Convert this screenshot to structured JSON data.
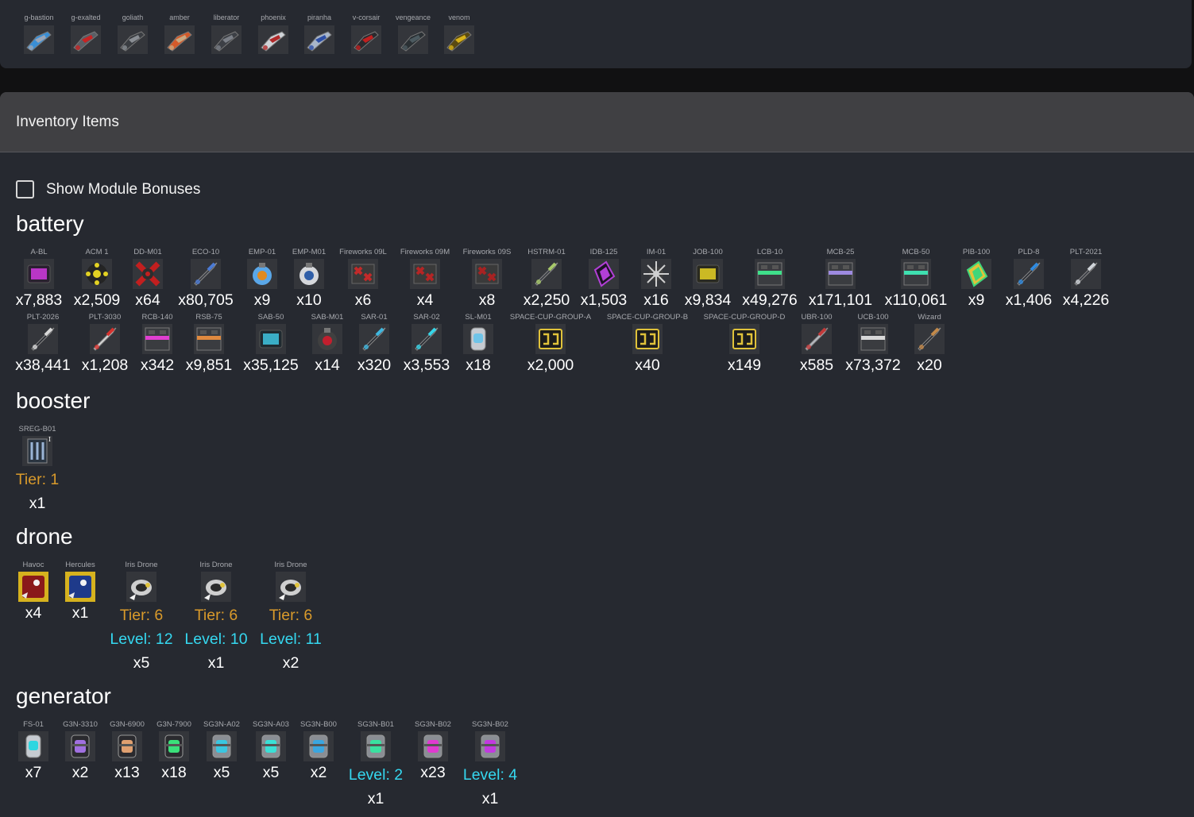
{
  "ships": [
    {
      "name": "g-bastion",
      "colors": [
        "#9aa6b8",
        "#3a8fd6"
      ]
    },
    {
      "name": "g-exalted",
      "colors": [
        "#c72323",
        "#5a5f66"
      ]
    },
    {
      "name": "goliath",
      "colors": [
        "#8a8e94",
        "#3a3d42"
      ]
    },
    {
      "name": "amber",
      "colors": [
        "#c9a880",
        "#d35a2a"
      ]
    },
    {
      "name": "liberator",
      "colors": [
        "#7c8088",
        "#3d4046"
      ]
    },
    {
      "name": "phoenix",
      "colors": [
        "#b02a2a",
        "#cfd3d8"
      ]
    },
    {
      "name": "piranha",
      "colors": [
        "#2d4fa6",
        "#a9b6c9"
      ]
    },
    {
      "name": "v-corsair",
      "colors": [
        "#c01f1f",
        "#2a2a2e"
      ]
    },
    {
      "name": "vengeance",
      "colors": [
        "#4c5a60",
        "#2a3034"
      ]
    },
    {
      "name": "venom",
      "colors": [
        "#d8b21a",
        "#5a4a12"
      ]
    }
  ],
  "inventory": {
    "title": "Inventory Items",
    "show_bonuses_label": "Show Module Bonuses",
    "categories": [
      {
        "name": "battery",
        "items": [
          {
            "name": "A-BL",
            "qty": "x7,883",
            "icon": "box-icon",
            "colors": [
              "#d23be0",
              "#2a2030"
            ]
          },
          {
            "name": "ACM 1",
            "qty": "x2,509",
            "icon": "mine-icon",
            "colors": [
              "#e3d223",
              "#242424"
            ]
          },
          {
            "name": "DD-M01",
            "qty": "x64",
            "icon": "x-mine-icon",
            "colors": [
              "#c21f1f",
              "#2d2d2d"
            ]
          },
          {
            "name": "ECO-10",
            "qty": "x80,705",
            "icon": "rocket-icon",
            "colors": [
              "#4b7bd6",
              "#3a3d44"
            ]
          },
          {
            "name": "EMP-01",
            "qty": "x9",
            "icon": "emp-icon",
            "colors": [
              "#e08a1f",
              "#5aa7e8"
            ]
          },
          {
            "name": "EMP-M01",
            "qty": "x10",
            "icon": "emp-icon",
            "colors": [
              "#2f5ea8",
              "#d6d8dc"
            ]
          },
          {
            "name": "Fireworks 09L",
            "qty": "x6",
            "icon": "firework-box-icon",
            "colors": [
              "#c22a2a",
              "#3a3a3a"
            ]
          },
          {
            "name": "Fireworks 09M",
            "qty": "x4",
            "icon": "firework-box-icon",
            "colors": [
              "#b52525",
              "#3a3a3a"
            ]
          },
          {
            "name": "Fireworks 09S",
            "qty": "x8",
            "icon": "firework-box-icon",
            "colors": [
              "#a82222",
              "#3a3a3a"
            ]
          },
          {
            "name": "HSTRM-01",
            "qty": "x2,250",
            "icon": "rocket-icon",
            "colors": [
              "#a8c96a",
              "#3a3d44"
            ]
          },
          {
            "name": "IDB-125",
            "qty": "x1,503",
            "icon": "crystal-icon",
            "colors": [
              "#b23fd6",
              "#1c1424"
            ]
          },
          {
            "name": "IM-01",
            "qty": "x16",
            "icon": "spiky-mine-icon",
            "colors": [
              "#cfcfcf",
              "#404040"
            ]
          },
          {
            "name": "JOB-100",
            "qty": "x9,834",
            "icon": "box-icon",
            "colors": [
              "#e7d226",
              "#2a2a20"
            ]
          },
          {
            "name": "LCB-10",
            "qty": "x49,276",
            "icon": "crate-icon",
            "colors": [
              "#3fe08a",
              "#3a3c40"
            ]
          },
          {
            "name": "MCB-25",
            "qty": "x171,101",
            "icon": "crate-icon",
            "colors": [
              "#9d8ae0",
              "#3a3c40"
            ]
          },
          {
            "name": "MCB-50",
            "qty": "x110,061",
            "icon": "crate-icon",
            "colors": [
              "#3fe0b0",
              "#3a3c40"
            ]
          },
          {
            "name": "PIB-100",
            "qty": "x9",
            "icon": "crystal-icon",
            "colors": [
              "#3fd67a",
              "#e0c23a"
            ]
          },
          {
            "name": "PLD-8",
            "qty": "x1,406",
            "icon": "rocket-icon",
            "colors": [
              "#2f8be0",
              "#2a2d33"
            ]
          },
          {
            "name": "PLT-2021",
            "qty": "x4,226",
            "icon": "rocket-icon",
            "colors": [
              "#cfd3d8",
              "#3a3d44"
            ]
          }
        ],
        "items2": [
          {
            "name": "PLT-2026",
            "qty": "x38,441",
            "icon": "rocket-icon",
            "colors": [
              "#d8d8d8",
              "#2a2d33"
            ]
          },
          {
            "name": "PLT-3030",
            "qty": "x1,208",
            "icon": "rocket-icon",
            "colors": [
              "#d6322e",
              "#d8d8d8"
            ]
          },
          {
            "name": "RCB-140",
            "qty": "x342",
            "icon": "crate-icon",
            "colors": [
              "#e03fd0",
              "#3a3c40"
            ]
          },
          {
            "name": "RSB-75",
            "qty": "x9,851",
            "icon": "crate-icon",
            "colors": [
              "#e08a3f",
              "#3a3c40"
            ]
          },
          {
            "name": "SAB-50",
            "qty": "x35,125",
            "icon": "box-icon",
            "colors": [
              "#3fc6e0",
              "#1f2a30"
            ]
          },
          {
            "name": "SAB-M01",
            "qty": "x14",
            "icon": "emp-icon",
            "colors": [
              "#c21f2e",
              "#404040"
            ]
          },
          {
            "name": "SAR-01",
            "qty": "x320",
            "icon": "rocket-icon",
            "colors": [
              "#3fb8e0",
              "#2a2d33"
            ]
          },
          {
            "name": "SAR-02",
            "qty": "x3,553",
            "icon": "rocket-icon",
            "colors": [
              "#36d6e8",
              "#2a2d33"
            ]
          },
          {
            "name": "SL-M01",
            "qty": "x18",
            "icon": "canister-icon",
            "colors": [
              "#6fc4e8",
              "#c6cbd1"
            ]
          },
          {
            "name": "SPACE-CUP-GROUP-A",
            "qty": "x2,000",
            "icon": "cup-box-icon",
            "colors": [
              "#e0c23a",
              "#1c1c1c"
            ]
          },
          {
            "name": "SPACE-CUP-GROUP-B",
            "qty": "x40",
            "icon": "cup-box-icon",
            "colors": [
              "#e0c23a",
              "#1c1c1c"
            ]
          },
          {
            "name": "SPACE-CUP-GROUP-D",
            "qty": "x149",
            "icon": "cup-box-icon",
            "colors": [
              "#e0c23a",
              "#1c1c1c"
            ]
          },
          {
            "name": "UBR-100",
            "qty": "x585",
            "icon": "rocket-icon",
            "colors": [
              "#c23a3a",
              "#b8bcc4"
            ]
          },
          {
            "name": "UCB-100",
            "qty": "x73,372",
            "icon": "crate-icon",
            "colors": [
              "#d8d8d8",
              "#3a3c40"
            ]
          },
          {
            "name": "Wizard",
            "qty": "x20",
            "icon": "rocket-icon",
            "colors": [
              "#c48a4a",
              "#2a2d33"
            ]
          }
        ]
      },
      {
        "name": "booster",
        "items": [
          {
            "name": "SREG-B01",
            "tier": "Tier: 1",
            "qty": "x1",
            "icon": "booster-icon",
            "colors": [
              "#9ab4d6",
              "#2a3440"
            ],
            "badge": "I"
          }
        ]
      },
      {
        "name": "drone",
        "items": [
          {
            "name": "Havoc",
            "qty": "x4",
            "icon": "drone-design-icon",
            "colors": [
              "#8a1a1a",
              "#d6b21e"
            ]
          },
          {
            "name": "Hercules",
            "qty": "x1",
            "icon": "drone-design-icon",
            "colors": [
              "#1e3a8a",
              "#d6b21e"
            ]
          },
          {
            "name": "Iris Drone",
            "tier": "Tier: 6",
            "level": "Level: 12",
            "qty": "x5",
            "icon": "iris-drone-icon",
            "colors": [
              "#cfcfcf",
              "#2a2a2a"
            ]
          },
          {
            "name": "Iris Drone",
            "tier": "Tier: 6",
            "level": "Level: 10",
            "qty": "x1",
            "icon": "iris-drone-icon",
            "colors": [
              "#cfcfcf",
              "#2a2a2a"
            ]
          },
          {
            "name": "Iris Drone",
            "tier": "Tier: 6",
            "level": "Level: 11",
            "qty": "x2",
            "icon": "iris-drone-icon",
            "colors": [
              "#cfcfcf",
              "#2a2a2a"
            ]
          }
        ]
      },
      {
        "name": "generator",
        "items": [
          {
            "name": "FS-01",
            "qty": "x7",
            "icon": "canister-icon",
            "colors": [
              "#2fd6e0",
              "#c6cbd1"
            ]
          },
          {
            "name": "G3N-3310",
            "qty": "x2",
            "icon": "generator-icon",
            "colors": [
              "#a070e0",
              "#2a2a2e"
            ]
          },
          {
            "name": "G3N-6900",
            "qty": "x13",
            "icon": "generator-icon",
            "colors": [
              "#e0a070",
              "#2a2a2e"
            ]
          },
          {
            "name": "G3N-7900",
            "qty": "x18",
            "icon": "generator-icon",
            "colors": [
              "#3ae07a",
              "#2a2a2e"
            ]
          },
          {
            "name": "SG3N-A02",
            "qty": "x5",
            "icon": "generator-icon",
            "colors": [
              "#3ac6e0",
              "#8a8e94"
            ]
          },
          {
            "name": "SG3N-A03",
            "qty": "x5",
            "icon": "generator-icon",
            "colors": [
              "#3ae0d6",
              "#8a8e94"
            ]
          },
          {
            "name": "SG3N-B00",
            "qty": "x2",
            "icon": "generator-icon",
            "colors": [
              "#3aa6e0",
              "#8a8e94"
            ]
          },
          {
            "name": "SG3N-B01",
            "level": "Level: 2",
            "qty": "x1",
            "icon": "generator-icon",
            "colors": [
              "#3ae0a0",
              "#8a8e94"
            ]
          },
          {
            "name": "SG3N-B02",
            "qty": "x23",
            "icon": "generator-icon",
            "colors": [
              "#e03ad0",
              "#8a8e94"
            ]
          },
          {
            "name": "SG3N-B02",
            "level": "Level: 4",
            "qty": "x1",
            "icon": "generator-icon",
            "colors": [
              "#c23ae0",
              "#8a8e94"
            ]
          }
        ]
      }
    ]
  }
}
